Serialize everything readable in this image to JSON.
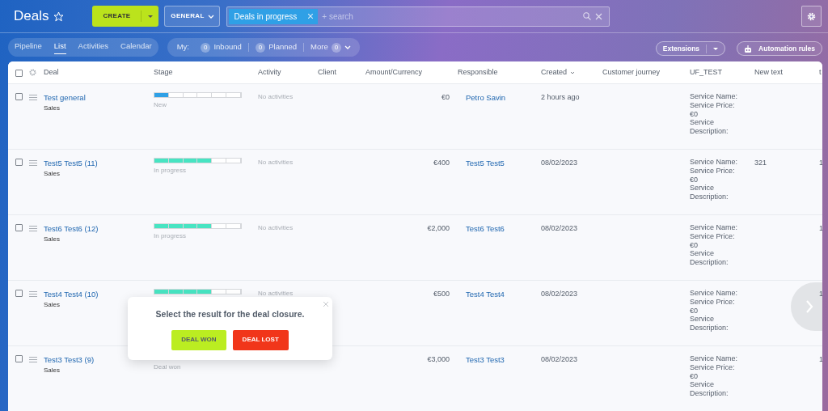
{
  "page": {
    "title": "Deals",
    "create_button": "CREATE",
    "category_button": "GENERAL",
    "filter_tag": "Deals in progress",
    "search": {
      "placeholder": "+ search"
    }
  },
  "view_tabs": [
    {
      "label": "Pipeline",
      "selected": false
    },
    {
      "label": "List",
      "selected": true
    },
    {
      "label": "Activities",
      "selected": false
    },
    {
      "label": "Calendar",
      "selected": false
    }
  ],
  "counters": {
    "label": "My:",
    "items": [
      {
        "count": "0",
        "label": "Inbound"
      },
      {
        "count": "0",
        "label": "Planned"
      }
    ],
    "more": {
      "label": "More",
      "count": "0"
    }
  },
  "toolbar_right": {
    "extensions": "Extensions",
    "automation": "Automation rules"
  },
  "table": {
    "columns": [
      "Deal",
      "Stage",
      "Activity",
      "Client",
      "Amount/Currency",
      "Responsible",
      "Created",
      "Customer journey",
      "UF_TEST",
      "New text",
      "t"
    ],
    "select_all_checked": false,
    "rows": [
      {
        "checked": false,
        "title": "Test general",
        "category": "Sales",
        "level": 0.1667,
        "stage": "New",
        "activity": "No activities",
        "amount": "€0",
        "responsible": "Petro Savin",
        "created": "2 hours ago",
        "uf_test": "Service Name:\nService Price: €0\nService Description:"
      },
      {
        "checked": false,
        "title": "Test5 Test5 (11)",
        "category": "Sales",
        "level": 0.6667,
        "stage": "In progress",
        "activity": "No activities",
        "amount": "€400",
        "responsible": "Test5 Test5",
        "created": "08/02/2023",
        "uf_test": "Service Name:\nService Price: €0\nService Description:",
        "new_text": "321",
        "column_10": "1"
      },
      {
        "checked": false,
        "title": "Test6 Test6 (12)",
        "category": "Sales",
        "level": 0.6667,
        "stage": "In progress",
        "activity": "No activities",
        "amount": "€2,000",
        "responsible": "Test6 Test6",
        "created": "08/02/2023",
        "uf_test": "Service Name:\nService Price: €0\nService Description:",
        "column_10": "1"
      },
      {
        "checked": false,
        "title": "Test4 Test4 (10)",
        "category": "Sales",
        "level": 0.6667,
        "activity": "No activities",
        "amount": "€500",
        "responsible": "Test4 Test4",
        "created": "08/02/2023",
        "uf_test": "Service Name:\nService Price: €0\nService Description:",
        "column_10": "1"
      },
      {
        "checked": false,
        "title": "Test3 Test3 (9)",
        "category": "Sales",
        "stage": "Deal won",
        "amount": "€3,000",
        "responsible": "Test3 Test3",
        "created": "08/02/2023",
        "uf_test": "Service Name:\nService Price: €0\nService Description:",
        "column_10": "1"
      }
    ]
  },
  "popup": {
    "message": "Select the result for the deal closure.",
    "buttons": [
      {
        "label": "DEAL WON",
        "kind": "won"
      },
      {
        "label": "DEAL LOST",
        "kind": "lost"
      }
    ]
  }
}
